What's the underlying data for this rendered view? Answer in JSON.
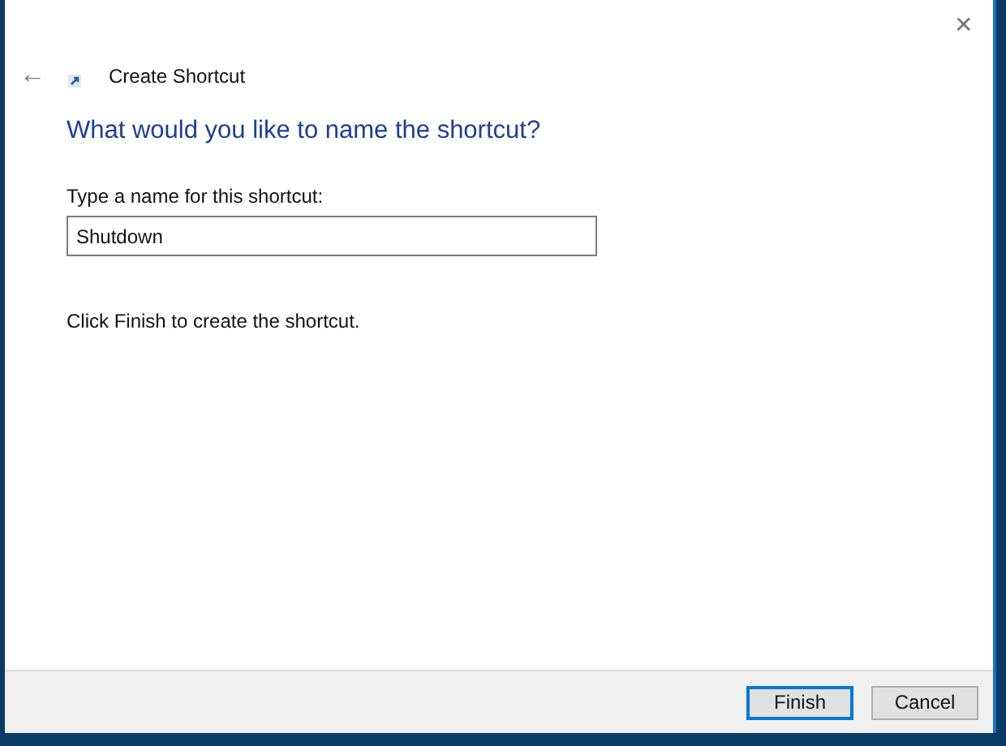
{
  "window": {
    "title": "Create Shortcut",
    "close": "✕"
  },
  "back": "←",
  "heading": "What would you like to name the shortcut?",
  "name_field": {
    "label": "Type a name for this shortcut:",
    "value": "Shutdown"
  },
  "instruction": "Click Finish to create the shortcut.",
  "buttons": [
    {
      "label": "Finish",
      "default": true
    },
    {
      "label": "Cancel",
      "default": false
    }
  ]
}
